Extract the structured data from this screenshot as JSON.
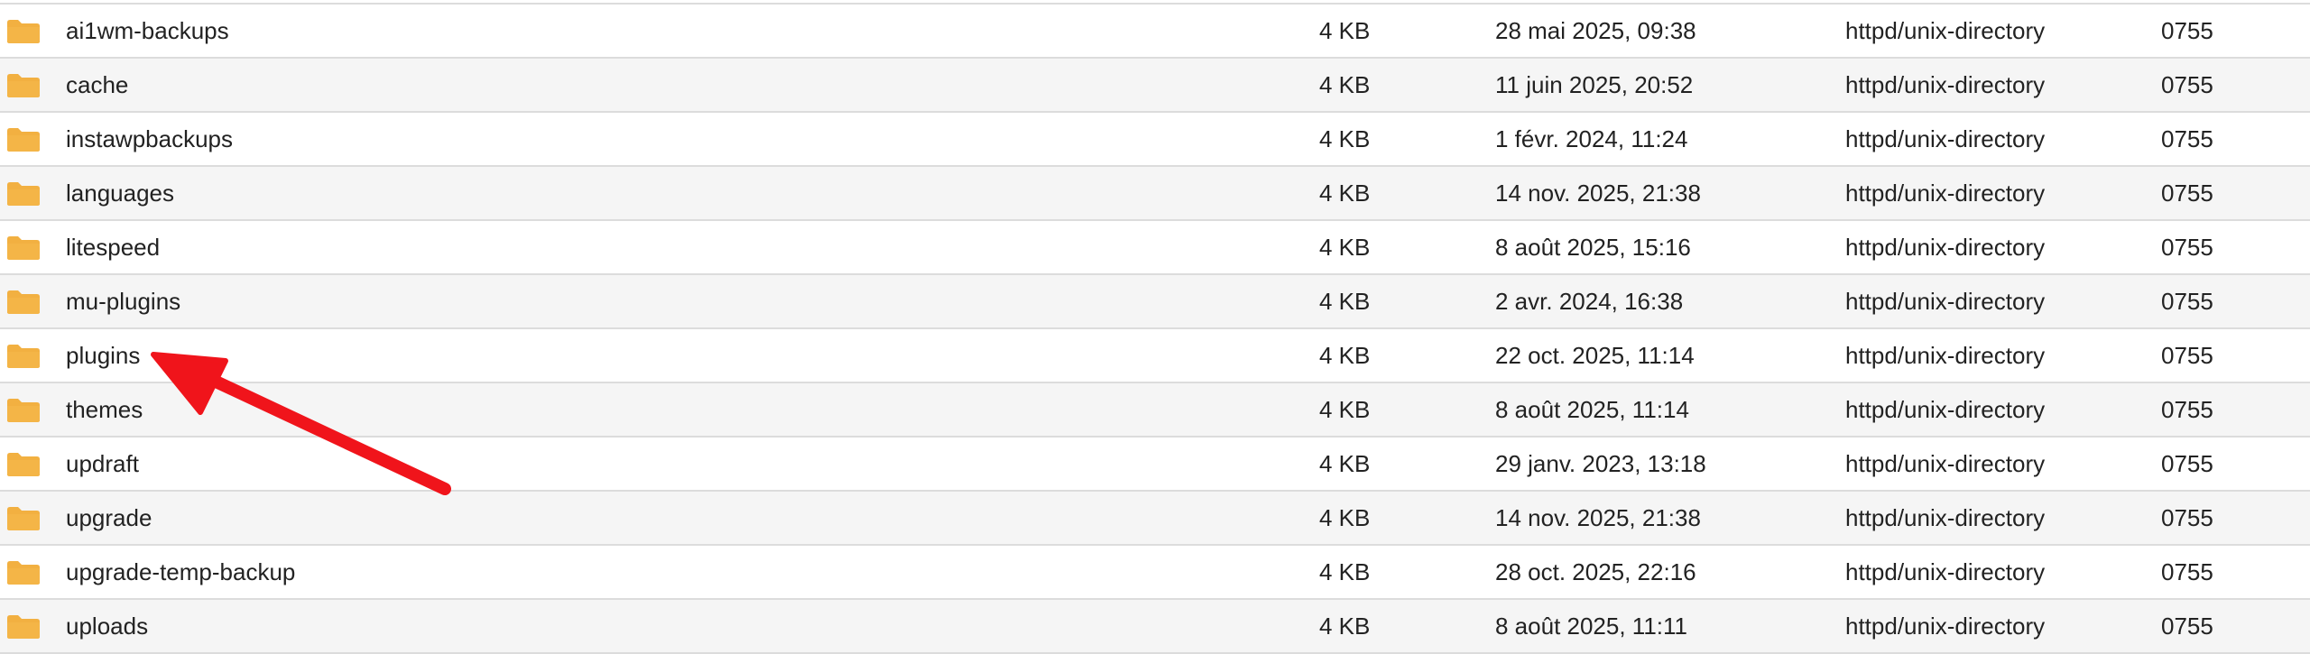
{
  "colors": {
    "folder_icon": "#F2B041",
    "row_alt_background": "#F5F5F5",
    "row_border": "#DCDCDC",
    "annotation_arrow": "#F0141B"
  },
  "icons": {
    "row_icon": "folder-icon",
    "annotation": "red-arrow-pointing-to-plugins"
  },
  "files": [
    {
      "name": "ai1wm-backups",
      "size": "4 KB",
      "modified": "28 mai 2025, 09:38",
      "type": "httpd/unix-directory",
      "perms": "0755"
    },
    {
      "name": "cache",
      "size": "4 KB",
      "modified": "11 juin 2025, 20:52",
      "type": "httpd/unix-directory",
      "perms": "0755"
    },
    {
      "name": "instawpbackups",
      "size": "4 KB",
      "modified": "1 févr. 2024, 11:24",
      "type": "httpd/unix-directory",
      "perms": "0755"
    },
    {
      "name": "languages",
      "size": "4 KB",
      "modified": "14 nov. 2025, 21:38",
      "type": "httpd/unix-directory",
      "perms": "0755"
    },
    {
      "name": "litespeed",
      "size": "4 KB",
      "modified": "8 août 2025, 15:16",
      "type": "httpd/unix-directory",
      "perms": "0755"
    },
    {
      "name": "mu-plugins",
      "size": "4 KB",
      "modified": "2 avr. 2024, 16:38",
      "type": "httpd/unix-directory",
      "perms": "0755"
    },
    {
      "name": "plugins",
      "size": "4 KB",
      "modified": "22 oct. 2025, 11:14",
      "type": "httpd/unix-directory",
      "perms": "0755"
    },
    {
      "name": "themes",
      "size": "4 KB",
      "modified": "8 août 2025, 11:14",
      "type": "httpd/unix-directory",
      "perms": "0755"
    },
    {
      "name": "updraft",
      "size": "4 KB",
      "modified": "29 janv. 2023, 13:18",
      "type": "httpd/unix-directory",
      "perms": "0755"
    },
    {
      "name": "upgrade",
      "size": "4 KB",
      "modified": "14 nov. 2025, 21:38",
      "type": "httpd/unix-directory",
      "perms": "0755"
    },
    {
      "name": "upgrade-temp-backup",
      "size": "4 KB",
      "modified": "28 oct. 2025, 22:16",
      "type": "httpd/unix-directory",
      "perms": "0755"
    },
    {
      "name": "uploads",
      "size": "4 KB",
      "modified": "8 août 2025, 11:11",
      "type": "httpd/unix-directory",
      "perms": "0755"
    }
  ]
}
